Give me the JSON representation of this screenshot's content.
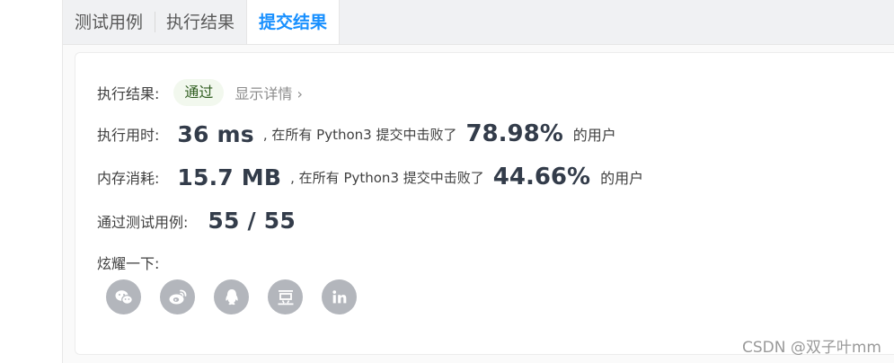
{
  "tabs": [
    {
      "label": "测试用例"
    },
    {
      "label": "执行结果"
    },
    {
      "label": "提交结果"
    }
  ],
  "result": {
    "label": "执行结果:",
    "status": "通过",
    "details": "显示详情",
    "details_chevron": "›"
  },
  "runtime": {
    "label": "执行用时:",
    "value": "36 ms",
    "text1": ", 在所有 Python3 提交中击败了",
    "percent": "78.98%",
    "text2": "的用户"
  },
  "memory": {
    "label": "内存消耗:",
    "value": "15.7 MB",
    "text1": ", 在所有 Python3 提交中击败了",
    "percent": "44.66%",
    "text2": "的用户"
  },
  "tests": {
    "label": "通过测试用例:",
    "value": "55 / 55"
  },
  "share": {
    "label": "炫耀一下:",
    "icons": [
      "wechat-icon",
      "weibo-icon",
      "qq-icon",
      "douban-icon",
      "linkedin-icon"
    ],
    "icon_color": "#b3b6bc"
  },
  "watermark": "CSDN @双子叶mm"
}
